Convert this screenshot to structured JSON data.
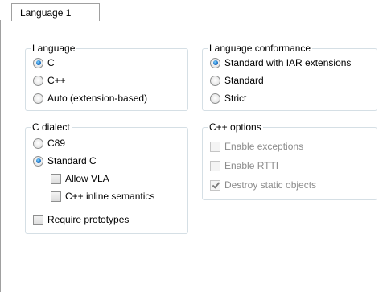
{
  "tab": {
    "label": "Language 1"
  },
  "language": {
    "title": "Language",
    "options": [
      {
        "label": "C",
        "checked": true
      },
      {
        "label": "C++",
        "checked": false
      },
      {
        "label": "Auto (extension-based)",
        "checked": false
      }
    ]
  },
  "conformance": {
    "title": "Language conformance",
    "options": [
      {
        "label": "Standard with IAR extensions",
        "checked": true
      },
      {
        "label": "Standard",
        "checked": false
      },
      {
        "label": "Strict",
        "checked": false
      }
    ]
  },
  "dialect": {
    "title": "C dialect",
    "options": [
      {
        "label": "C89",
        "checked": false
      },
      {
        "label": "Standard C",
        "checked": true
      }
    ],
    "allow_vla": "Allow VLA",
    "cpp_inline": "C++ inline semantics",
    "require_prototypes": "Require prototypes"
  },
  "cpp_options": {
    "title": "C++ options",
    "enable_exceptions": "Enable exceptions",
    "enable_rtti": "Enable RTTI",
    "destroy_static": "Destroy static objects"
  }
}
